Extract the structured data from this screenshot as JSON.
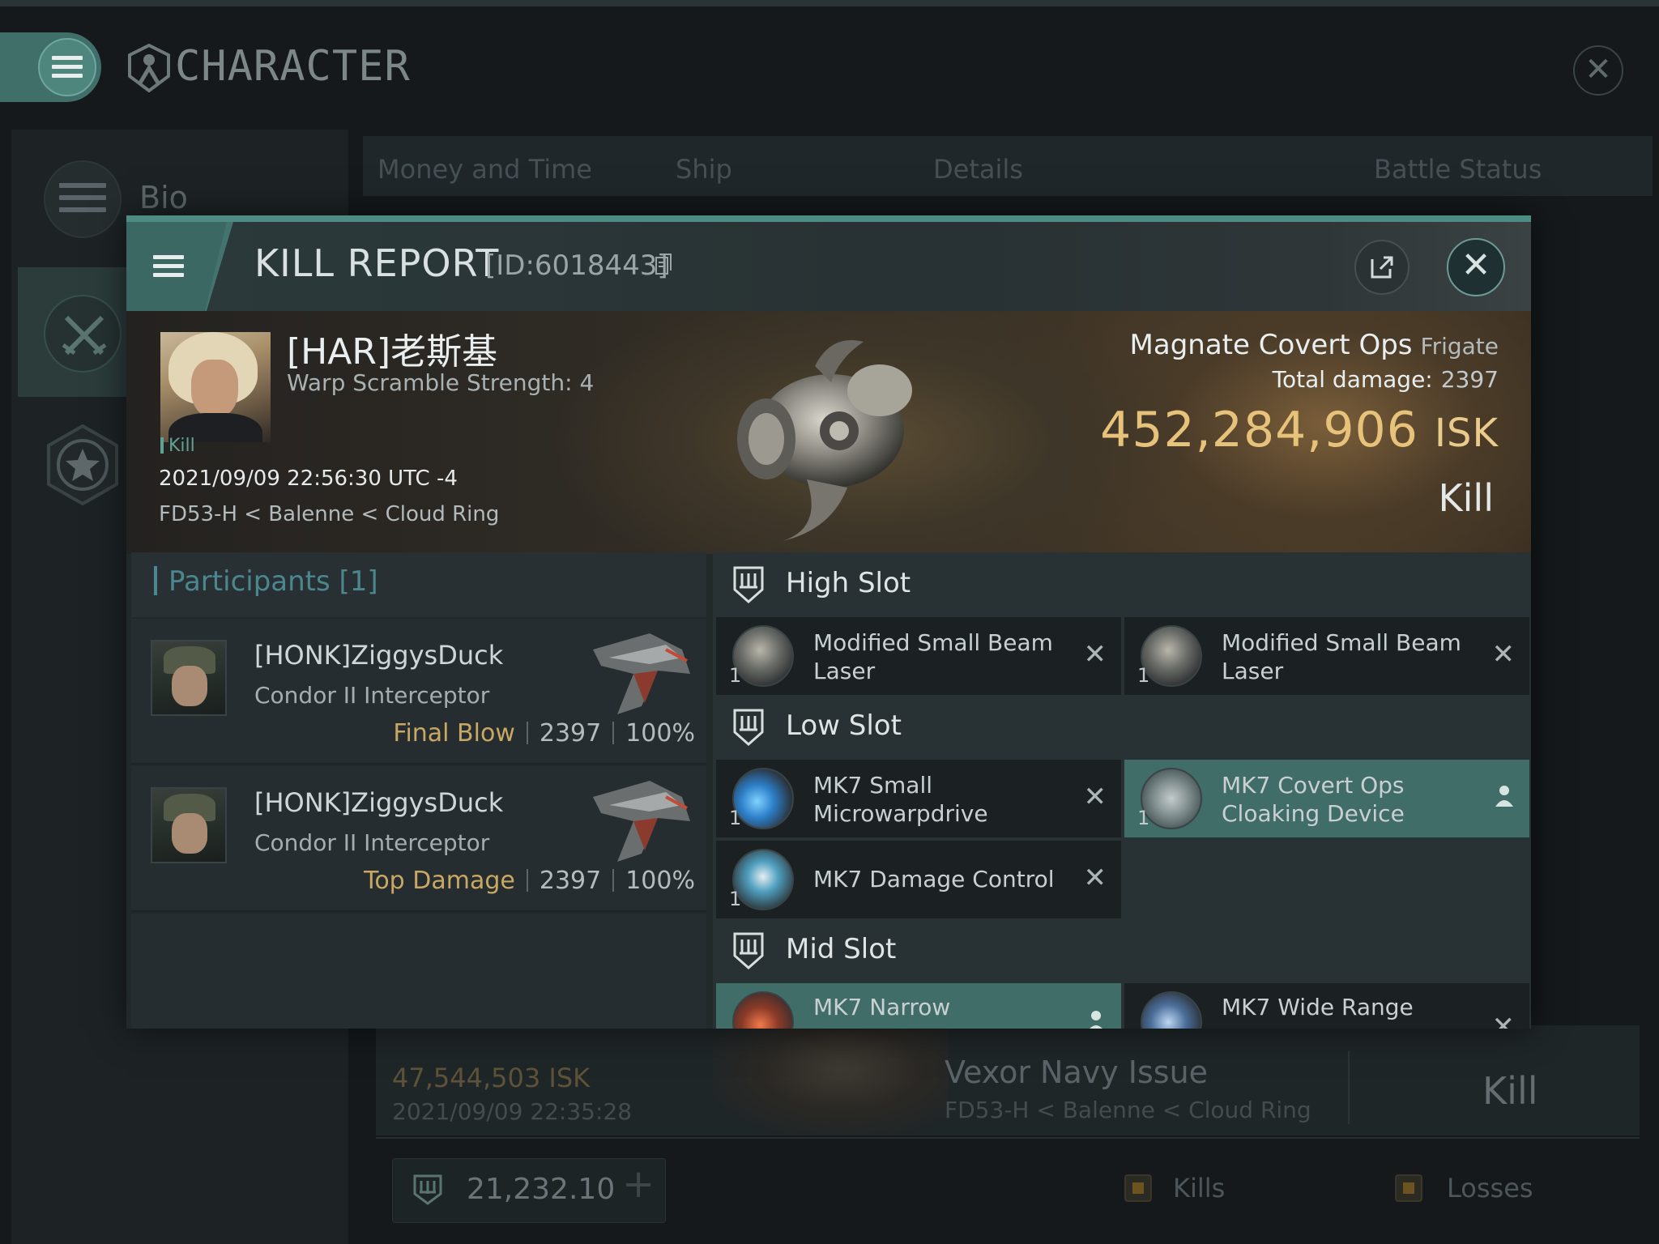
{
  "header": {
    "title": "CHARACTER"
  },
  "sidebar": {
    "bio_label": "Bio"
  },
  "bg_tabs": [
    "Money and Time",
    "Ship",
    "Details",
    "Battle Status"
  ],
  "bg_row": {
    "isk": "47,544,503 ISK",
    "date": "2021/09/09 22:35:28",
    "ship_name": "Vexor Navy Issue",
    "location": "FD53-H < Balenne < Cloud Ring",
    "result": "Kill"
  },
  "bg_footer": {
    "score": "21,232.10",
    "kills_label": "Kills",
    "losses_label": "Losses"
  },
  "kill_report": {
    "title": "KILL REPORT",
    "id": "[ID:6018443]",
    "victim": {
      "name": "[HAR]老斯基",
      "warp": "Warp Scramble Strength: 4",
      "tag": "Kill",
      "time": "2021/09/09 22:56:30 UTC -4",
      "location": "FD53-H < Balenne < Cloud Ring"
    },
    "ship": {
      "name": "Magnate Covert Ops",
      "class": "Frigate"
    },
    "damage_label": "Total damage:",
    "damage": "2397",
    "isk_value": "452,284,906",
    "isk_unit": "ISK",
    "result": "Kill",
    "participants_title": "Participants [1]",
    "participants": [
      {
        "name": "[HONK]ZiggysDuck",
        "ship": "Condor II Interceptor",
        "tag": "Final Blow",
        "damage": "2397",
        "percent": "100%"
      },
      {
        "name": "[HONK]ZiggysDuck",
        "ship": "Condor II Interceptor",
        "tag": "Top Damage",
        "damage": "2397",
        "percent": "100%"
      }
    ],
    "slots": {
      "high": {
        "title": "High Slot",
        "modules": [
          {
            "name": "Modified Small Beam Laser",
            "qty": "1",
            "state": "destroyed"
          },
          {
            "name": "Modified Small Beam Laser",
            "qty": "1",
            "state": "destroyed"
          }
        ]
      },
      "low": {
        "title": "Low Slot",
        "modules": [
          {
            "name": "MK7 Small Microwarpdrive",
            "qty": "1",
            "state": "destroyed"
          },
          {
            "name": "MK7 Covert Ops Cloaking Device",
            "qty": "1",
            "state": "dropped"
          },
          {
            "name": "MK7 Damage Control",
            "qty": "1",
            "state": "destroyed"
          }
        ]
      },
      "mid": {
        "title": "Mid Slot",
        "modules": [
          {
            "name": "MK7 Narrow",
            "qty": "",
            "state": "dropped"
          },
          {
            "name": "MK7 Wide Range",
            "qty": "",
            "state": "destroyed"
          }
        ]
      }
    },
    "destroyed_symbol": "✕"
  },
  "colors": {
    "accent": "#4e8b83",
    "isk": "#e7c27a",
    "tag": "#c8a862",
    "dropped_bg": "#416d68"
  },
  "icons": [
    "menu-icon",
    "character-emblem-icon",
    "close-icon",
    "share-icon",
    "copy-icon",
    "shield-slot-icon",
    "person-icon",
    "star-icon",
    "swords-icon"
  ]
}
